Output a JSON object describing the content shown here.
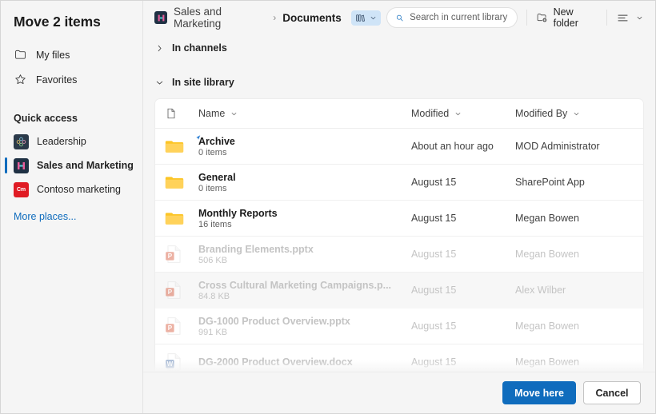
{
  "dialog": {
    "title": "Move 2 items"
  },
  "sidebar": {
    "nav": [
      {
        "label": "My files",
        "icon": "folder-icon"
      },
      {
        "label": "Favorites",
        "icon": "star-icon"
      }
    ],
    "quick_access_label": "Quick access",
    "places": [
      {
        "label": "Leadership",
        "icon": "site-leadership-icon",
        "selected": false
      },
      {
        "label": "Sales and Marketing",
        "icon": "site-sales-marketing-icon",
        "selected": true
      },
      {
        "label": "Contoso marketing",
        "icon": "site-contoso-marketing-icon",
        "badge": "Cm",
        "selected": false
      }
    ],
    "more_places_label": "More places..."
  },
  "topbar": {
    "breadcrumb": {
      "site": "Sales and Marketing",
      "separator": "›",
      "library": "Documents"
    },
    "search": {
      "placeholder": "Search in current library",
      "value": ""
    },
    "new_folder_label": "New folder",
    "view_options_label": ""
  },
  "groups": [
    {
      "label": "In channels",
      "expanded": false
    },
    {
      "label": "In site library",
      "expanded": true
    }
  ],
  "table": {
    "columns": {
      "icon": "",
      "name": "Name",
      "modified": "Modified",
      "modified_by": "Modified By"
    },
    "rows": [
      {
        "name": "Archive",
        "sub": "0 items",
        "modified": "About an hour ago",
        "modified_by": "MOD Administrator",
        "kind": "folder",
        "disabled": false,
        "hover": false,
        "cursor": true
      },
      {
        "name": "General",
        "sub": "0 items",
        "modified": "August 15",
        "modified_by": "SharePoint App",
        "kind": "folder",
        "disabled": false,
        "hover": false,
        "cursor": false
      },
      {
        "name": "Monthly Reports",
        "sub": "16 items",
        "modified": "August 15",
        "modified_by": "Megan Bowen",
        "kind": "folder",
        "disabled": false,
        "hover": false,
        "cursor": false
      },
      {
        "name": "Branding Elements.pptx",
        "sub": "506 KB",
        "modified": "August 15",
        "modified_by": "Megan Bowen",
        "kind": "pptx",
        "disabled": true,
        "hover": false,
        "cursor": false
      },
      {
        "name": "Cross Cultural Marketing Campaigns.p...",
        "sub": "84.8 KB",
        "modified": "August 15",
        "modified_by": "Alex Wilber",
        "kind": "pptx",
        "disabled": true,
        "hover": true,
        "cursor": false
      },
      {
        "name": "DG-1000 Product Overview.pptx",
        "sub": "991 KB",
        "modified": "August 15",
        "modified_by": "Megan Bowen",
        "kind": "pptx",
        "disabled": true,
        "hover": false,
        "cursor": false
      },
      {
        "name": "DG-2000 Product Overview.docx",
        "sub": "",
        "modified": "August 15",
        "modified_by": "Megan Bowen",
        "kind": "docx",
        "disabled": true,
        "hover": false,
        "cursor": false
      }
    ]
  },
  "footer": {
    "primary_label": "Move here",
    "secondary_label": "Cancel"
  },
  "colors": {
    "accent": "#0f6cbd",
    "link": "#0f6cbd",
    "folder": "#fcc526",
    "pptx": "#d24726",
    "docx": "#2b579a",
    "surface": "#f5f5f5"
  }
}
